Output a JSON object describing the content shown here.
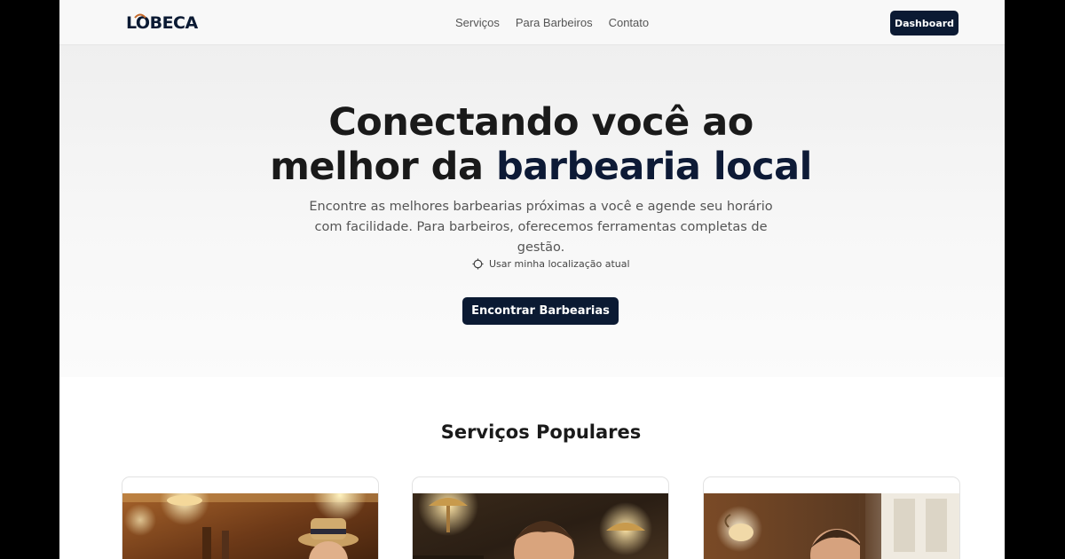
{
  "header": {
    "logo_text": "LOBECA",
    "nav": [
      "Serviços",
      "Para Barbeiros",
      "Contato"
    ],
    "dashboard_label": "Dashboard"
  },
  "hero": {
    "title_line1": "Conectando você ao",
    "title_line2_prefix": "melhor da",
    "title_line2_accent": "barbearia local",
    "subtitle": "Encontre as melhores barbearias próximas a você e agende seu horário com facilidade. Para barbeiros, oferecemos ferramentas completas de gestão.",
    "location_label": "Usar minha localização atual",
    "cta_label": "Encontrar Barbearias"
  },
  "services": {
    "title": "Serviços Populares"
  },
  "colors": {
    "brand_navy": "#0b1a33",
    "logo_accent": "#c46a2b"
  },
  "icons": {
    "location": "crosshair-icon"
  }
}
